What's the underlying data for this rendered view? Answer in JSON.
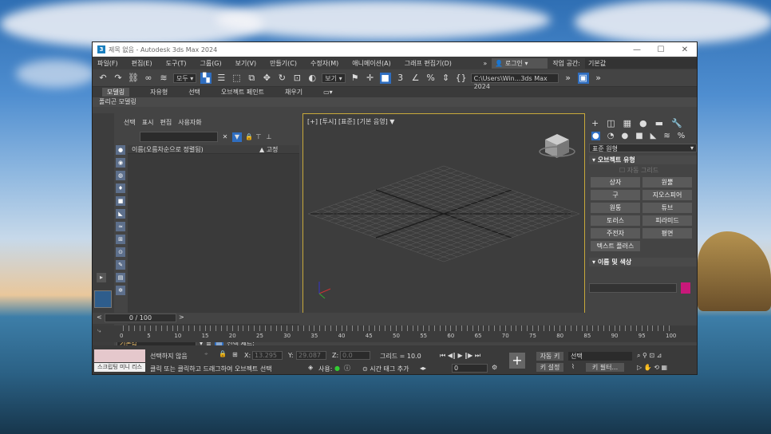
{
  "window": {
    "title": "제목 없음 - Autodesk 3ds Max 2024",
    "minimize": "—",
    "maximize": "☐",
    "close": "✕"
  },
  "menu": {
    "items": [
      "파일(F)",
      "편집(E)",
      "도구(T)",
      "그룹(G)",
      "보기(V)",
      "만들기(C)",
      "수정자(M)",
      "애니메이션(A)",
      "그래프 편집기(D)"
    ],
    "more": "»",
    "login": "로그인",
    "workspace_label": "작업 공간:",
    "workspace_value": "기본값"
  },
  "toolbar": {
    "selection_filter": "모두",
    "reference_coord": "보기",
    "path_box": "C:\\Users\\Win...3ds Max 2024"
  },
  "ribbon": {
    "tabs": [
      "모델링",
      "자유형",
      "선택",
      "오브젝트 페인트",
      "채우기"
    ],
    "sub": "폴리곤 모델링"
  },
  "scene_explorer": {
    "menus": [
      "선택",
      "표시",
      "편집",
      "사용자화"
    ],
    "col_name": "이름(오름차순으로 정렬됨)",
    "col_frozen": "▲ 고정",
    "layer_value": "기본값",
    "selection_set": "선택 세트:"
  },
  "viewport": {
    "label": "[+] [투시] [표준] [기본 음영]"
  },
  "command_panel": {
    "dropdown": "표준 원형",
    "rollout_object_type": "오브젝트 유형",
    "autogrid": "자동 그리드",
    "buttons": [
      "상자",
      "원뿔",
      "구",
      "지오스피어",
      "원통",
      "튜브",
      "토러스",
      "피라미드",
      "주전자",
      "평면",
      "텍스트 플러스"
    ],
    "rollout_name_color": "이름 및 색상",
    "swatch_color": "#c8197a"
  },
  "timeslider": {
    "value": "0 / 100",
    "ticks": [
      "0",
      "5",
      "10",
      "15",
      "20",
      "25",
      "30",
      "35",
      "40",
      "45",
      "50",
      "55",
      "60",
      "65",
      "70",
      "75",
      "80",
      "85",
      "90",
      "95",
      "100"
    ]
  },
  "status": {
    "selection": "선택하지 않음",
    "prompt": "클릭 또는 클릭하고 드래그하여 오브젝트 선택",
    "x_label": "X:",
    "x_value": "13.295",
    "y_label": "Y:",
    "y_value": "29.087",
    "z_label": "Z:",
    "z_value": "0.0",
    "grid": "그리드 = 10.0",
    "enabled": "사용:",
    "time_tag": "시간 태그 추가",
    "autokey": "자동 키",
    "setkey": "키 설정",
    "selected": "선택",
    "keyfilter": "키 필터...",
    "frame": "0",
    "mini_listener": "스크립팅 미니 리스"
  }
}
